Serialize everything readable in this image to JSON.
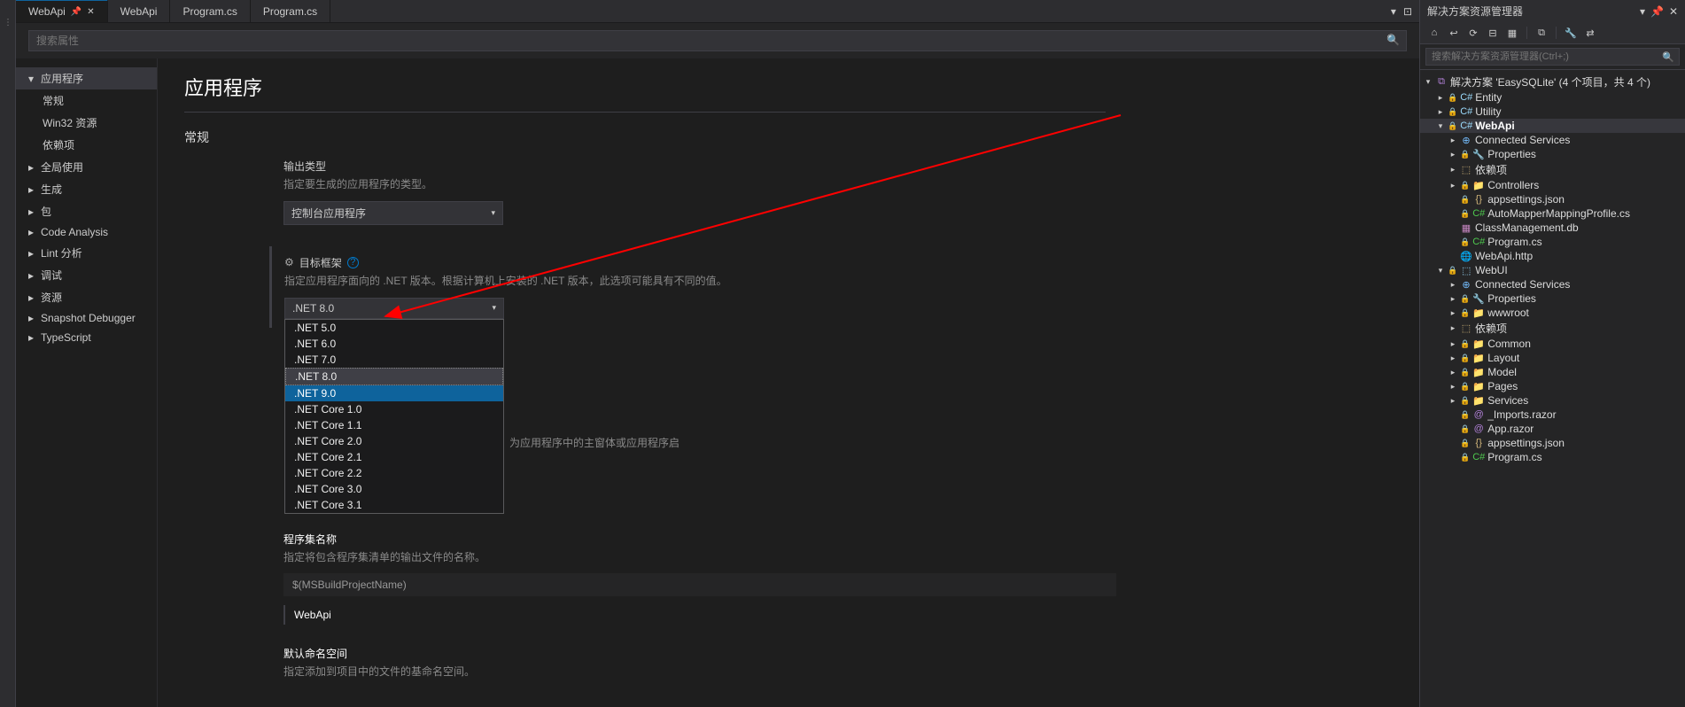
{
  "tabs": [
    {
      "label": "WebApi",
      "active": true
    },
    {
      "label": "WebApi",
      "active": false
    },
    {
      "label": "Program.cs",
      "active": false
    },
    {
      "label": "Program.cs",
      "active": false
    }
  ],
  "search": {
    "placeholder": "搜索属性"
  },
  "sidebar": {
    "items": [
      {
        "label": "应用程序",
        "caret": "▾",
        "sel": true
      },
      {
        "label": "常规",
        "sub": true
      },
      {
        "label": "Win32 资源",
        "sub": true
      },
      {
        "label": "依赖项",
        "sub": true
      },
      {
        "label": "全局使用",
        "caret": "▸"
      },
      {
        "label": "生成",
        "caret": "▸"
      },
      {
        "label": "包",
        "caret": "▸"
      },
      {
        "label": "Code Analysis",
        "caret": "▸"
      },
      {
        "label": "Lint 分析",
        "caret": "▸"
      },
      {
        "label": "调试",
        "caret": "▸"
      },
      {
        "label": "资源",
        "caret": "▸"
      },
      {
        "label": "Snapshot Debugger",
        "caret": "▸"
      },
      {
        "label": "TypeScript",
        "caret": "▸"
      }
    ]
  },
  "page": {
    "title": "应用程序",
    "section_general": "常规",
    "output_type": {
      "title": "输出类型",
      "desc": "指定要生成的应用程序的类型。",
      "value": "控制台应用程序"
    },
    "target_framework": {
      "title": "目标框架",
      "desc": "指定应用程序面向的 .NET 版本。根据计算机上安装的 .NET 版本，此选项可能具有不同的值。",
      "value": ".NET 8.0",
      "options": [
        ".NET 5.0",
        ".NET 6.0",
        ".NET 7.0",
        ".NET 8.0",
        ".NET 9.0",
        ".NET Core 1.0",
        ".NET Core 1.1",
        ".NET Core 2.0",
        ".NET Core 2.1",
        ".NET Core 2.2",
        ".NET Core 3.0",
        ".NET Core 3.1"
      ],
      "selected_index": 3,
      "highlighted_index": 4,
      "hidden_desc": "为应用程序中的主窗体或应用程序启"
    },
    "assembly_name": {
      "title": "程序集名称",
      "desc": "指定将包含程序集清单的输出文件的名称。",
      "value": "$(MSBuildProjectName)",
      "resolved": "WebApi"
    },
    "default_namespace": {
      "title": "默认命名空间",
      "desc": "指定添加到项目中的文件的基命名空间。"
    }
  },
  "right_panel": {
    "title": "解决方案资源管理器",
    "search_placeholder": "搜索解决方案资源管理器(Ctrl+;)",
    "solution_label": "解决方案 'EasySQLite' (4 个项目，共 4 个)",
    "tree": [
      {
        "d": 1,
        "tw": "▸",
        "ic": "C#",
        "cls": "c-proj",
        "txt": "Entity",
        "lk": true
      },
      {
        "d": 1,
        "tw": "▸",
        "ic": "C#",
        "cls": "c-proj",
        "txt": "Utility",
        "lk": true
      },
      {
        "d": 1,
        "tw": "▾",
        "ic": "C#",
        "cls": "c-proj",
        "txt": "WebApi",
        "lk": true,
        "bold": true,
        "sel": true
      },
      {
        "d": 2,
        "tw": "▸",
        "ic": "⊕",
        "cls": "c-svc",
        "txt": "Connected Services"
      },
      {
        "d": 2,
        "tw": "▸",
        "ic": "🔧",
        "cls": "c-gear",
        "txt": "Properties",
        "lk": true
      },
      {
        "d": 2,
        "tw": "▸",
        "ic": "⬚",
        "cls": "c-fold",
        "txt": "依赖项"
      },
      {
        "d": 2,
        "tw": "▸",
        "ic": "📁",
        "cls": "c-fold",
        "txt": "Controllers",
        "lk": true
      },
      {
        "d": 2,
        "tw": "",
        "ic": "{}",
        "cls": "c-json",
        "txt": "appsettings.json",
        "lk": true
      },
      {
        "d": 2,
        "tw": "",
        "ic": "C#",
        "cls": "c-cs",
        "txt": "AutoMapperMappingProfile.cs",
        "lk": true
      },
      {
        "d": 2,
        "tw": "",
        "ic": "▦",
        "cls": "c-db",
        "txt": "ClassManagement.db"
      },
      {
        "d": 2,
        "tw": "",
        "ic": "C#",
        "cls": "c-cs",
        "txt": "Program.cs",
        "lk": true
      },
      {
        "d": 2,
        "tw": "",
        "ic": "🌐",
        "cls": "c-file",
        "txt": "WebApi.http"
      },
      {
        "d": 1,
        "tw": "▾",
        "ic": "⬚",
        "cls": "c-proj",
        "txt": "WebUI",
        "lk": true
      },
      {
        "d": 2,
        "tw": "▸",
        "ic": "⊕",
        "cls": "c-svc",
        "txt": "Connected Services"
      },
      {
        "d": 2,
        "tw": "▸",
        "ic": "🔧",
        "cls": "c-gear",
        "txt": "Properties",
        "lk": true
      },
      {
        "d": 2,
        "tw": "▸",
        "ic": "📁",
        "cls": "c-fold",
        "txt": "wwwroot",
        "lk": true
      },
      {
        "d": 2,
        "tw": "▸",
        "ic": "⬚",
        "cls": "c-fold",
        "txt": "依赖项"
      },
      {
        "d": 2,
        "tw": "▸",
        "ic": "📁",
        "cls": "c-fold",
        "txt": "Common",
        "lk": true
      },
      {
        "d": 2,
        "tw": "▸",
        "ic": "📁",
        "cls": "c-fold",
        "txt": "Layout",
        "lk": true
      },
      {
        "d": 2,
        "tw": "▸",
        "ic": "📁",
        "cls": "c-fold",
        "txt": "Model",
        "lk": true
      },
      {
        "d": 2,
        "tw": "▸",
        "ic": "📁",
        "cls": "c-fold",
        "txt": "Pages",
        "lk": true
      },
      {
        "d": 2,
        "tw": "▸",
        "ic": "📁",
        "cls": "c-fold",
        "txt": "Services",
        "lk": true
      },
      {
        "d": 2,
        "tw": "",
        "ic": "@",
        "cls": "c-razor",
        "txt": "_Imports.razor",
        "lk": true
      },
      {
        "d": 2,
        "tw": "",
        "ic": "@",
        "cls": "c-razor",
        "txt": "App.razor",
        "lk": true
      },
      {
        "d": 2,
        "tw": "",
        "ic": "{}",
        "cls": "c-json",
        "txt": "appsettings.json",
        "lk": true
      },
      {
        "d": 2,
        "tw": "",
        "ic": "C#",
        "cls": "c-cs",
        "txt": "Program.cs",
        "lk": true
      }
    ]
  }
}
